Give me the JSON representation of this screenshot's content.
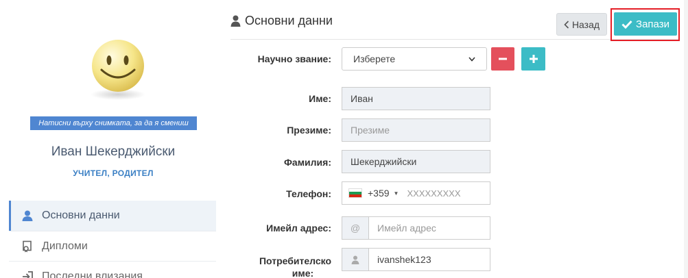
{
  "sidebar": {
    "photo_hint": "Натисни върху снимката, за да я смениш",
    "profile_name": "Иван Шекерджийски",
    "profile_roles": "УЧИТЕЛ, РОДИТЕЛ",
    "nav": [
      {
        "label": "Основни данни",
        "icon": "user-icon",
        "active": true
      },
      {
        "label": "Дипломи",
        "icon": "certificate-icon",
        "active": false
      },
      {
        "label": "Последни влизания",
        "icon": "sign-in-icon",
        "active": false
      }
    ]
  },
  "header": {
    "title": "Основни данни",
    "back_label": "Назад",
    "save_label": "Запази"
  },
  "form": {
    "degree_label": "Научно звание:",
    "degree_selected": "Изберете",
    "first_name_label": "Име:",
    "first_name_value": "Иван",
    "middle_name_label": "Презиме:",
    "middle_name_placeholder": "Презиме",
    "last_name_label": "Фамилия:",
    "last_name_value": "Шекерджийски",
    "phone_label": "Телефон:",
    "phone_code": "+359",
    "phone_placeholder": "XXXXXXXXX",
    "email_label": "Имейл адрес:",
    "email_addon": "@",
    "email_placeholder": "Имейл адрес",
    "username_label_line1": "Потребителско",
    "username_label_line2": "име:",
    "username_value": "ivanshek123"
  },
  "colors": {
    "accent": "#3cbcc6",
    "danger": "#e4505c",
    "highlight": "#e41e26",
    "link": "#3a7fc4"
  }
}
